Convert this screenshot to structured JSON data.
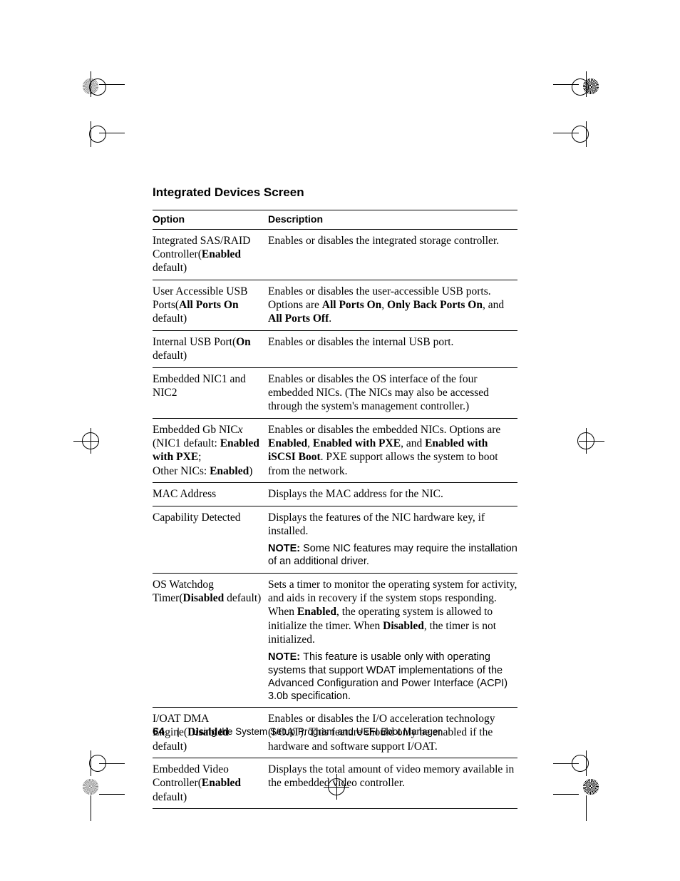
{
  "heading": "Integrated Devices Screen",
  "table_headers": {
    "option": "Option",
    "description": "Description"
  },
  "rows": [
    {
      "opt": [
        {
          "t": "Integrated SAS/RAID Controller"
        },
        {
          "t": "(",
          "nowrap": true
        },
        {
          "t": "Enabled",
          "b": true,
          "inline": true
        },
        {
          "t": " default)",
          "inline": true
        }
      ],
      "desc": [
        {
          "blocks": [
            {
              "t": "Enables or disables the integrated storage controller."
            }
          ]
        }
      ]
    },
    {
      "opt": [
        {
          "t": "User Accessible USB Ports"
        },
        {
          "t": "(",
          "nowrap": true
        },
        {
          "t": "All Ports On",
          "b": true,
          "inline": true
        },
        {
          "t": " default)",
          "inline": true
        }
      ],
      "desc": [
        {
          "blocks": [
            {
              "t": "Enables or disables the user-accessible USB ports. Options are "
            },
            {
              "t": "All Ports On",
              "b": true
            },
            {
              "t": ", "
            },
            {
              "t": "Only Back Ports On",
              "b": true
            },
            {
              "t": ", and "
            },
            {
              "t": "All Ports Off",
              "b": true
            },
            {
              "t": "."
            }
          ]
        }
      ]
    },
    {
      "opt": [
        {
          "t": "Internal USB Port"
        },
        {
          "t": "(",
          "nowrap": true
        },
        {
          "t": "On",
          "b": true,
          "inline": true
        },
        {
          "t": " default)",
          "inline": true
        }
      ],
      "desc": [
        {
          "blocks": [
            {
              "t": "Enables or disables the internal USB port."
            }
          ]
        }
      ]
    },
    {
      "opt": [
        {
          "t": "Embedded NIC1 and NIC2"
        }
      ],
      "desc": [
        {
          "blocks": [
            {
              "t": "Enables or disables the OS interface of the four embedded NICs. (The NICs may also be accessed through the system's management controller.)"
            }
          ]
        }
      ]
    },
    {
      "opt": [
        {
          "t": "Embedded Gb NIC"
        },
        {
          "t": "x",
          "i": true,
          "inline": true
        },
        {
          "t": "(NIC1 default: ",
          "br": true
        },
        {
          "t": "Enabled with PXE",
          "b": true,
          "inline": true
        },
        {
          "t": ";",
          "inline": true
        },
        {
          "t": "Other NICs: ",
          "br": true
        },
        {
          "t": "Enabled",
          "b": true,
          "inline": true
        },
        {
          "t": ")",
          "inline": true
        }
      ],
      "desc": [
        {
          "blocks": [
            {
              "t": "Enables or disables the embedded NICs. Options are "
            },
            {
              "t": "Enabled",
              "b": true
            },
            {
              "t": ", "
            },
            {
              "t": "Enabled with PXE",
              "b": true
            },
            {
              "t": ", and "
            },
            {
              "t": "Enabled with iSCSI Boot",
              "b": true
            },
            {
              "t": ". PXE support allows the system to boot from the network."
            }
          ]
        }
      ]
    },
    {
      "opt": [
        {
          "t": "MAC Address"
        }
      ],
      "desc": [
        {
          "blocks": [
            {
              "t": "Displays the MAC address for the NIC."
            }
          ]
        }
      ]
    },
    {
      "opt": [
        {
          "t": "Capability Detected"
        }
      ],
      "desc": [
        {
          "blocks": [
            {
              "t": "Displays the features of the NIC hardware key, if installed."
            }
          ]
        },
        {
          "note": true,
          "blocks": [
            {
              "t": "NOTE: ",
              "notelabel": true
            },
            {
              "t": "Some NIC features may require the installation of an additional driver."
            }
          ]
        }
      ]
    },
    {
      "opt": [
        {
          "t": "OS Watchdog Timer"
        },
        {
          "t": "(",
          "nowrap": true
        },
        {
          "t": "Disabled",
          "b": true,
          "inline": true
        },
        {
          "t": " default)",
          "inline": true
        }
      ],
      "desc": [
        {
          "blocks": [
            {
              "t": "Sets a timer to monitor the operating system for activity, and aids in recovery if the system stops responding. When "
            },
            {
              "t": "Enabled",
              "b": true
            },
            {
              "t": ", the operating system is allowed to initialize the timer. When "
            },
            {
              "t": "Disabled",
              "b": true
            },
            {
              "t": ", the timer is not initialized."
            }
          ]
        },
        {
          "note": true,
          "blocks": [
            {
              "t": "NOTE: ",
              "notelabel": true
            },
            {
              "t": "This feature is usable only with operating systems that support WDAT implementations of the Advanced Configuration and Power Interface (ACPI) 3.0b specification."
            }
          ]
        }
      ]
    },
    {
      "opt": [
        {
          "t": "I/OAT DMA Engine"
        },
        {
          "t": "(",
          "nowrap": true
        },
        {
          "t": "Disabled",
          "b": true,
          "inline": true
        },
        {
          "t": " default)",
          "inline": true
        }
      ],
      "desc": [
        {
          "blocks": [
            {
              "t": "Enables or disables the I/O acceleration technology (I/OAT). This feature should only be enabled if the hardware and software support I/OAT."
            }
          ]
        }
      ]
    },
    {
      "opt": [
        {
          "t": "Embedded Video Controller"
        },
        {
          "t": "(",
          "nowrap": true
        },
        {
          "t": "Enabled",
          "b": true,
          "inline": true
        },
        {
          "t": " default)",
          "inline": true
        }
      ],
      "desc": [
        {
          "blocks": [
            {
              "t": "Displays the total amount of video memory available in the embedded video controller."
            }
          ]
        }
      ]
    }
  ],
  "footer": {
    "page": "64",
    "text": "Using the System Setup Program and UEFI Boot Manager"
  }
}
